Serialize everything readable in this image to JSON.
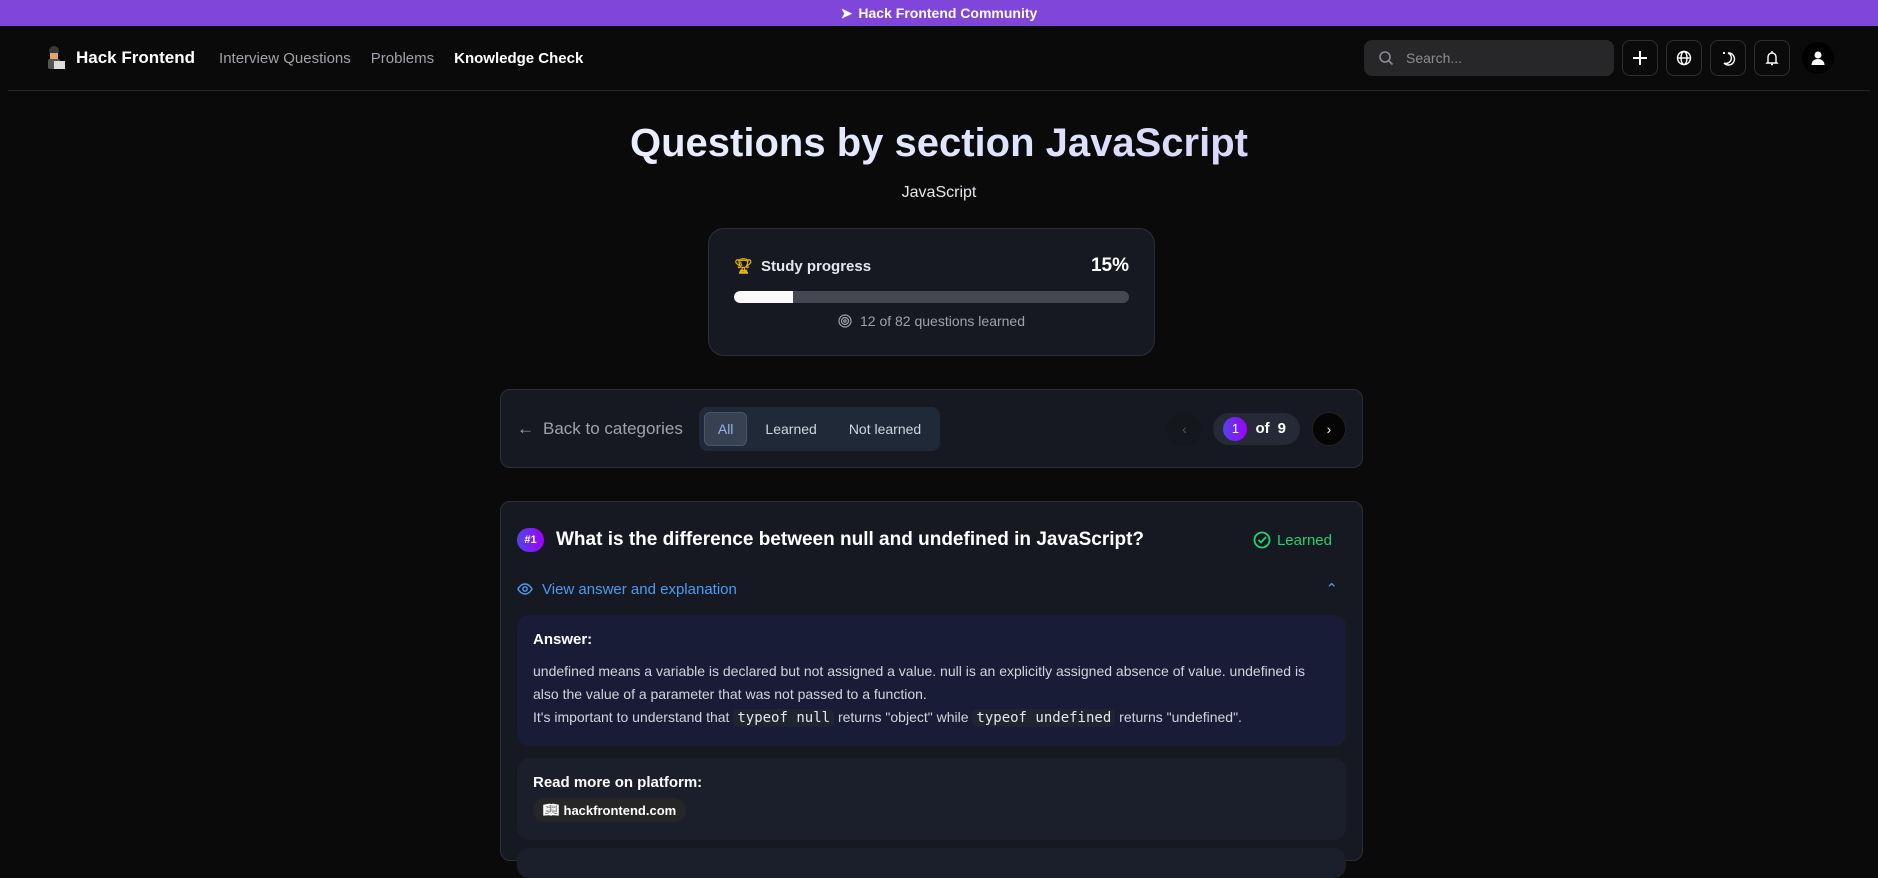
{
  "banner": {
    "text": "Hack Frontend Community"
  },
  "nav": {
    "brand": "Hack Frontend",
    "links": [
      "Interview Questions",
      "Problems",
      "Knowledge Check"
    ],
    "search_placeholder": "Search..."
  },
  "page": {
    "title": "Questions by section JavaScript",
    "subtitle": "JavaScript"
  },
  "progress": {
    "label": "Study progress",
    "percent_text": "15%",
    "percent": 15,
    "note": "12 of 82 questions learned"
  },
  "controls": {
    "back": "Back to categories",
    "filters": [
      "All",
      "Learned",
      "Not learned"
    ],
    "active_filter": "All",
    "page": "1",
    "of": "of",
    "total": "9"
  },
  "question": {
    "number": "#1",
    "title": "What is the difference between null and undefined in JavaScript?",
    "status": "Learned",
    "toggle": "View answer and explanation",
    "answer_heading": "Answer:",
    "answer_line1": "undefined means a variable is declared but not assigned a value. null is an explicitly assigned absence of value. undefined is also the value of a parameter that was not passed to a function.",
    "answer_line2_a": "It's important to understand that",
    "code1": "typeof null",
    "answer_line2_b": "returns \"object\" while",
    "code2": "typeof undefined",
    "answer_line2_c": "returns \"undefined\".",
    "more_heading": "Read more on platform:",
    "more_link": "hackfrontend.com"
  },
  "colors": {
    "banner": "#8046d9",
    "accent": "#4b9cf0",
    "learned": "#22d36b",
    "trophy": "#eab308"
  }
}
